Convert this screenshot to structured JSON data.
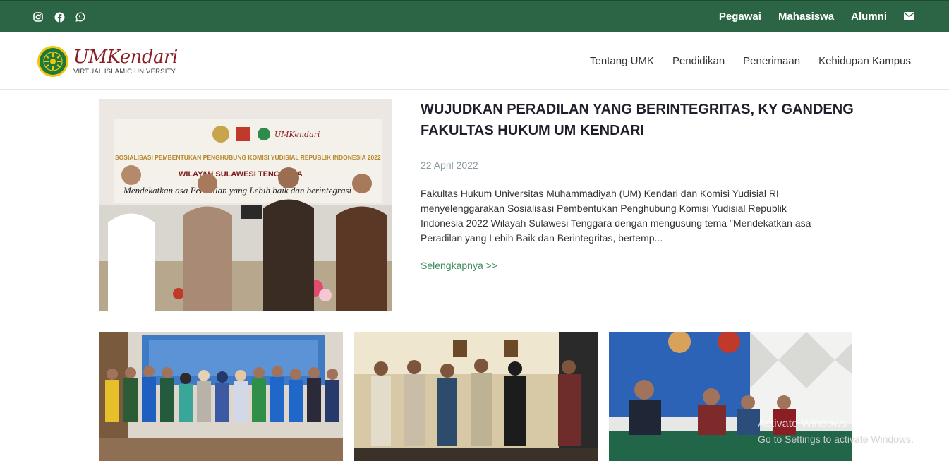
{
  "topbar": {
    "social_icons": [
      "instagram-icon",
      "facebook-icon",
      "whatsapp-icon"
    ],
    "links": [
      "Pegawai",
      "Mahasiswa",
      "Alumni"
    ],
    "mail_icon": "envelope-icon",
    "bg_color": "#2b6545"
  },
  "brand": {
    "name": "UMKendari",
    "tagline": "VIRTUAL ISLAMIC UNIVERSITY",
    "color": "#8b1d24"
  },
  "nav": {
    "items": [
      "Tentang UMK",
      "Pendidikan",
      "Penerimaan",
      "Kehidupan Kampus"
    ]
  },
  "featured": {
    "title": "WUJUDKAN PERADILAN YANG BERINTEGRITAS, KY GANDENG FAKULTAS HUKUM UM KENDARI",
    "date": "22 April 2022",
    "excerpt": "Fakultas Hukum Universitas Muhammadiyah (UM) Kendari dan Komisi Yudisial RI\n menyelenggarakan Sosialisasi Pembentukan Penghubung Komisi Yudisial Republik\nIndonesia 2022 Wilayah Sulawesi Tenggara dengan mengusung tema \"Mendekatkan asa\nPeradilan yang Lebih Baik dan Berintegritas, bertemp...",
    "read_more": "Selengkapnya >>",
    "banner_lines": [
      "SOSIALISASI PEMBENTUKAN PENGHUBUNG KOMISI YUDISIAL REPUBLIK INDONESIA 2022",
      "WILAYAH SULAWESI TENGGARA",
      "Mendekatkan asa Peradilan yang Lebih baik dan berintegrasi"
    ]
  },
  "watermark": {
    "line1": "Activate Windows",
    "line2": "Go to Settings to activate Windows."
  }
}
